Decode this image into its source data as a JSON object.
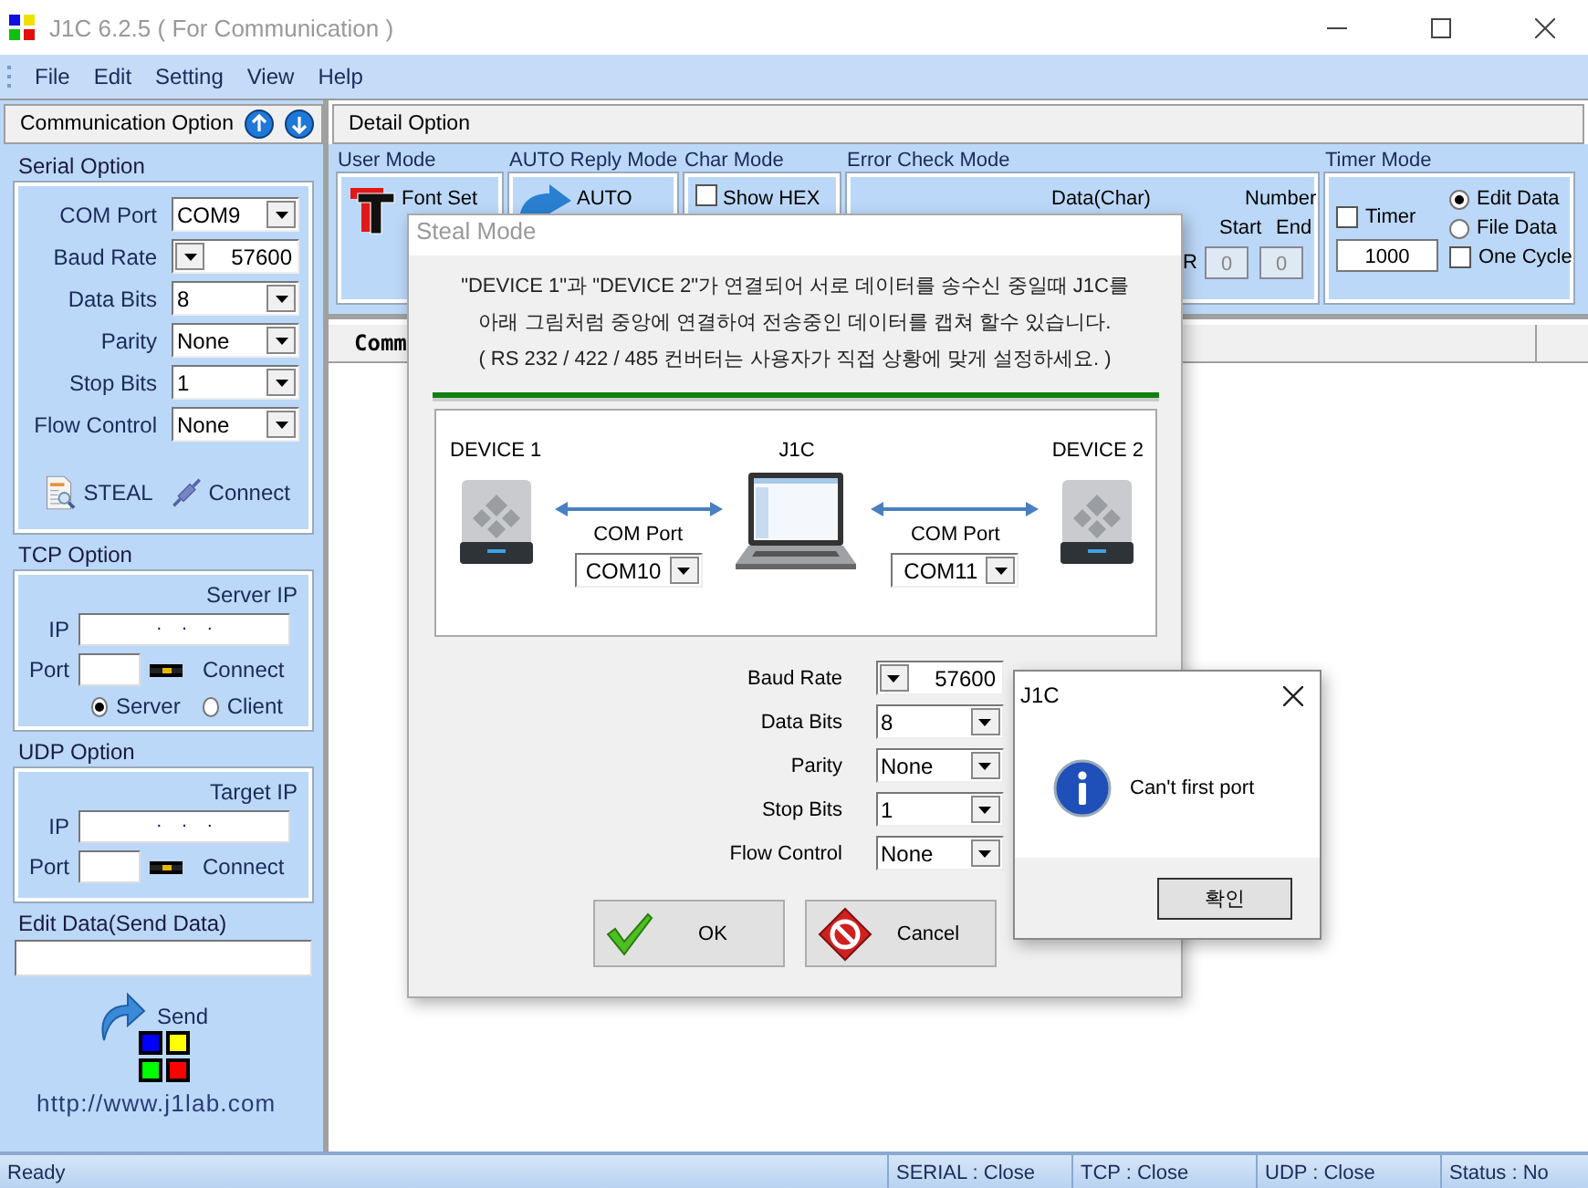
{
  "window": {
    "title": "J1C 6.2.5 ( For Communication )"
  },
  "menu": [
    "File",
    "Edit",
    "Setting",
    "View",
    "Help"
  ],
  "communication_option": {
    "title": "Communication Option",
    "serial_option": {
      "title": "Serial Option",
      "fields": [
        {
          "label": "COM Port",
          "value": "COM9",
          "kind": "combo"
        },
        {
          "label": "Baud Rate",
          "value": "57600",
          "kind": "spin"
        },
        {
          "label": "Data Bits",
          "value": "8",
          "kind": "combo"
        },
        {
          "label": "Parity",
          "value": "None",
          "kind": "combo"
        },
        {
          "label": "Stop Bits",
          "value": "1",
          "kind": "combo"
        },
        {
          "label": "Flow Control",
          "value": "None",
          "kind": "combo"
        }
      ],
      "steal": "STEAL",
      "connect": "Connect"
    },
    "tcp_option": {
      "title": "TCP Option",
      "ip_caption": "Server IP",
      "ip_label": "IP",
      "ip_value": ".    .    .",
      "port_label": "Port",
      "connect": "Connect",
      "modes": [
        {
          "label": "Server",
          "selected": true
        },
        {
          "label": "Client",
          "selected": false
        }
      ]
    },
    "udp_option": {
      "title": "UDP Option",
      "ip_caption": "Target IP",
      "ip_label": "IP",
      "ip_value": ".    .    .",
      "port_label": "Port",
      "connect": "Connect"
    },
    "edit_data": {
      "title": "Edit Data(Send Data)"
    },
    "send": "Send",
    "link": "http://www.j1lab.com"
  },
  "detail_option": {
    "title": "Detail Option",
    "user_mode": {
      "title": "User Mode",
      "font_set": "Font Set"
    },
    "auto_reply_mode": {
      "title": "AUTO Reply Mode",
      "button": "AUTO"
    },
    "char_mode": {
      "title": "Char Mode",
      "show_hex": {
        "label": "Show HEX",
        "checked": false
      }
    },
    "error_check_mode": {
      "title": "Error Check Mode",
      "data_label": "Data(Char)",
      "number_label": "Number",
      "start_label": "Start",
      "end_label": "End",
      "r_label": "R",
      "start": "0",
      "end": "0"
    },
    "timer_mode": {
      "title": "Timer Mode",
      "timer": {
        "label": "Timer",
        "checked": false
      },
      "interval": "1000",
      "sources": [
        {
          "label": "Edit Data",
          "selected": true
        },
        {
          "label": "File Data",
          "selected": false
        }
      ],
      "one_cycle": {
        "label": "One Cycle",
        "checked": false
      }
    },
    "table": {
      "columns": [
        "Comm"
      ]
    }
  },
  "steal_mode": {
    "title": "Steal Mode",
    "lines": [
      "\"DEVICE 1\"과 \"DEVICE 2\"가 연결되어 서로 데이터를 송수신 중일때 J1C를",
      "아래 그림처럼 중앙에 연결하여 전송중인 데이터를 캡쳐 할수 있습니다.",
      "( RS 232 / 422 / 485 컨버터는 사용자가 직접 상황에 맞게 설정하세요. )"
    ],
    "diagram": {
      "device_1": "DEVICE 1",
      "center": "J1C",
      "device_2": "DEVICE 2",
      "port_label_1": "COM Port",
      "port_1": "COM10",
      "port_label_2": "COM Port",
      "port_2": "COM11"
    },
    "fields": [
      {
        "label": "Baud Rate",
        "value": "57600",
        "kind": "spin"
      },
      {
        "label": "Data Bits",
        "value": "8",
        "kind": "combo"
      },
      {
        "label": "Parity",
        "value": "None",
        "kind": "combo"
      },
      {
        "label": "Stop Bits",
        "value": "1",
        "kind": "combo"
      },
      {
        "label": "Flow Control",
        "value": "None",
        "kind": "combo"
      }
    ],
    "buttons": [
      {
        "label": "OK",
        "kind": "ok"
      },
      {
        "label": "Cancel",
        "kind": "cancel"
      }
    ]
  },
  "message_box": {
    "title": "J1C",
    "message": "Can't first port",
    "button": "확인"
  },
  "status_bar": [
    "Ready",
    "SERIAL : Close",
    "TCP : Close",
    "UDP : Close",
    "Status : No"
  ]
}
